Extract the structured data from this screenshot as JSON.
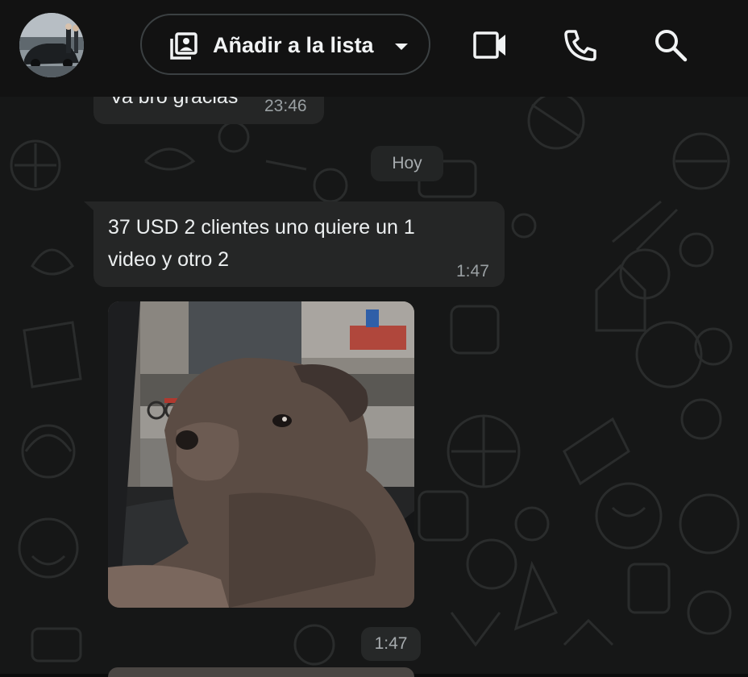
{
  "header": {
    "list_button_label": "Añadir a la lista",
    "icons": [
      "avatar",
      "add-to-list-icon",
      "chevron-down-icon",
      "video-call-icon",
      "voice-call-icon",
      "search-icon"
    ]
  },
  "messages": {
    "previous": {
      "text": "Va bro gracias",
      "time": "23:46"
    },
    "date_divider": "Hoy",
    "text_message": {
      "line1": "37 USD 2 clientes uno quiere un 1",
      "line2": "video y otro 2",
      "time": "1:47"
    },
    "media_message": {
      "time": "1:47"
    }
  },
  "colors": {
    "header_bg": "#121212",
    "chat_bg": "#161717",
    "bubble_bg": "#252626",
    "text": "#eceff0",
    "meta_text": "#9aa0a3"
  }
}
